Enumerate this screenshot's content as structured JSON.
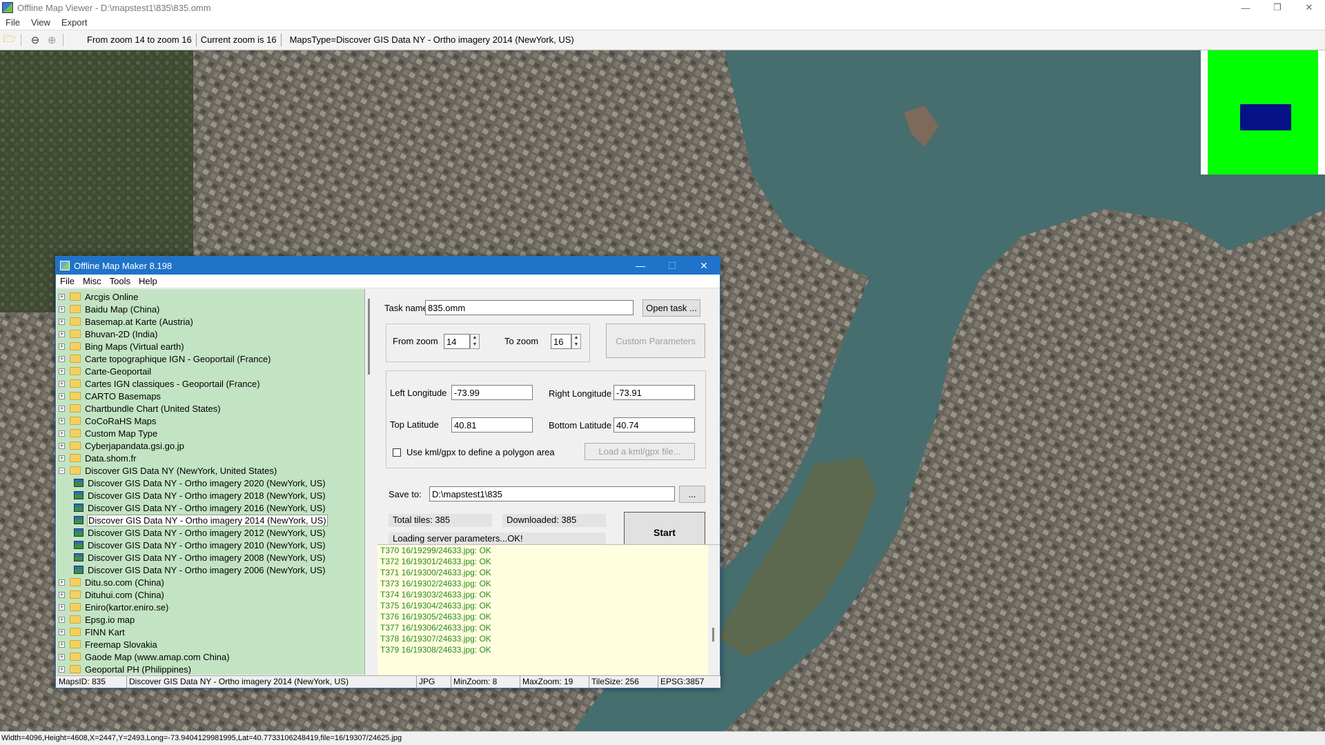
{
  "window": {
    "title": "Offline Map Viewer - D:\\mapstest1\\835\\835.omm",
    "controls": [
      "—",
      "❐",
      "✕"
    ]
  },
  "menubar": [
    "File",
    "View",
    "Export"
  ],
  "toolbar": {
    "segments": [
      "From zoom 14 to zoom 16",
      "Current zoom is 16",
      "MapsType=Discover GIS Data NY - Ortho imagery 2014 (NewYork, US)"
    ]
  },
  "statusbar": "Width=4096,Height=4608,X=2447,Y=2493,Long=-73.9404129981995,Lat=40.7733106248419,file=16/19307/24625.jpg",
  "dialog": {
    "title": "Offline Map Maker 8.198",
    "menu": [
      "File",
      "Misc",
      "Tools",
      "Help"
    ],
    "tree": [
      {
        "label": "Arcgis Online",
        "kind": "folder",
        "exp": "+"
      },
      {
        "label": "Baidu Map (China)",
        "kind": "folder",
        "exp": "+"
      },
      {
        "label": "Basemap.at Karte (Austria)",
        "kind": "folder",
        "exp": "+"
      },
      {
        "label": "Bhuvan-2D (India)",
        "kind": "folder",
        "exp": "+"
      },
      {
        "label": "Bing Maps (Virtual earth)",
        "kind": "folder",
        "exp": "+"
      },
      {
        "label": "Carte topographique IGN - Geoportail (France)",
        "kind": "folder",
        "exp": "+"
      },
      {
        "label": "Carte-Geoportail",
        "kind": "folder",
        "exp": "+"
      },
      {
        "label": "Cartes IGN classiques - Geoportail (France)",
        "kind": "folder",
        "exp": "+"
      },
      {
        "label": "CARTO Basemaps",
        "kind": "folder",
        "exp": "+"
      },
      {
        "label": "Chartbundle Chart (United States)",
        "kind": "folder",
        "exp": "+"
      },
      {
        "label": "CoCoRaHS Maps",
        "kind": "folder",
        "exp": "+"
      },
      {
        "label": "Custom Map Type",
        "kind": "folder",
        "exp": "+"
      },
      {
        "label": "Cyberjapandata.gsi.go.jp",
        "kind": "folder",
        "exp": "+"
      },
      {
        "label": "Data.shom.fr",
        "kind": "folder",
        "exp": "+"
      },
      {
        "label": "Discover GIS Data NY (NewYork, United States)",
        "kind": "folder",
        "exp": "−"
      },
      {
        "label": "Discover GIS Data NY - Ortho imagery 2020 (NewYork, US)",
        "kind": "map"
      },
      {
        "label": "Discover GIS Data NY - Ortho imagery 2018 (NewYork, US)",
        "kind": "map"
      },
      {
        "label": "Discover GIS Data NY - Ortho imagery 2016 (NewYork, US)",
        "kind": "map"
      },
      {
        "label": "Discover GIS Data NY - Ortho imagery 2014 (NewYork, US)",
        "kind": "map",
        "selected": true
      },
      {
        "label": "Discover GIS Data NY - Ortho imagery 2012 (NewYork, US)",
        "kind": "map"
      },
      {
        "label": "Discover GIS Data NY - Ortho imagery 2010 (NewYork, US)",
        "kind": "map"
      },
      {
        "label": "Discover GIS Data NY - Ortho imagery 2008 (NewYork, US)",
        "kind": "map"
      },
      {
        "label": "Discover GIS Data NY - Ortho imagery 2006 (NewYork, US)",
        "kind": "map"
      },
      {
        "label": "Ditu.so.com (China)",
        "kind": "folder",
        "exp": "+"
      },
      {
        "label": "Dituhui.com (China)",
        "kind": "folder",
        "exp": "+"
      },
      {
        "label": "Eniro(kartor.eniro.se)",
        "kind": "folder",
        "exp": "+"
      },
      {
        "label": "Epsg.io map",
        "kind": "folder",
        "exp": "+"
      },
      {
        "label": "FINN Kart",
        "kind": "folder",
        "exp": "+"
      },
      {
        "label": "Freemap Slovakia",
        "kind": "folder",
        "exp": "+"
      },
      {
        "label": "Gaode Map (www.amap.com China)",
        "kind": "folder",
        "exp": "+"
      },
      {
        "label": "Geoportal PH (Philippines)",
        "kind": "folder",
        "exp": "+"
      }
    ],
    "form": {
      "task_name_label": "Task name",
      "task_name_value": "835.omm",
      "open_task_label": "Open task ...",
      "from_zoom_label": "From zoom",
      "from_zoom_value": "14",
      "to_zoom_label": "To zoom",
      "to_zoom_value": "16",
      "custom_params_label": "Custom Parameters",
      "left_lon_label": "Left Longitude",
      "left_lon_value": "-73.99",
      "right_lon_label": "Right Longitude",
      "right_lon_value": "-73.91",
      "top_lat_label": "Top Latitude",
      "top_lat_value": "40.81",
      "bottom_lat_label": "Bottom Latitude",
      "bottom_lat_value": "40.74",
      "kml_label": "Use kml/gpx to define a polygon area",
      "load_kml_label": "Load a kml/gpx file...",
      "save_to_label": "Save to:",
      "save_to_value": "D:\\mapstest1\\835",
      "browse_label": "...",
      "total_tiles": "Total tiles: 385",
      "downloaded": "Downloaded: 385",
      "loading": "Loading server parameters...OK!",
      "start_label": "Start"
    },
    "log": [
      "T370 16/19299/24633.jpg: OK",
      "T372 16/19301/24633.jpg: OK",
      "T371 16/19300/24633.jpg: OK",
      "T373 16/19302/24633.jpg: OK",
      "T374 16/19303/24633.jpg: OK",
      "T375 16/19304/24633.jpg: OK",
      "T376 16/19305/24633.jpg: OK",
      "T377 16/19306/24633.jpg: OK",
      "T378 16/19307/24633.jpg: OK",
      "T379 16/19308/24633.jpg: OK"
    ],
    "status": [
      "MapsID: 835",
      "Discover GIS Data NY - Ortho imagery 2014 (NewYork, US)",
      "JPG",
      "MinZoom: 8",
      "MaxZoom: 19",
      "TileSize: 256",
      "EPSG:3857"
    ]
  },
  "colors": {
    "water": "#466e6e",
    "tree_bg": "#c3e4c3",
    "log_bg": "#ffffe0",
    "log_text": "#2a8a19",
    "overview_green": "#00ff00",
    "overview_blue": "#061285",
    "title_blue": "#1f73c9"
  }
}
